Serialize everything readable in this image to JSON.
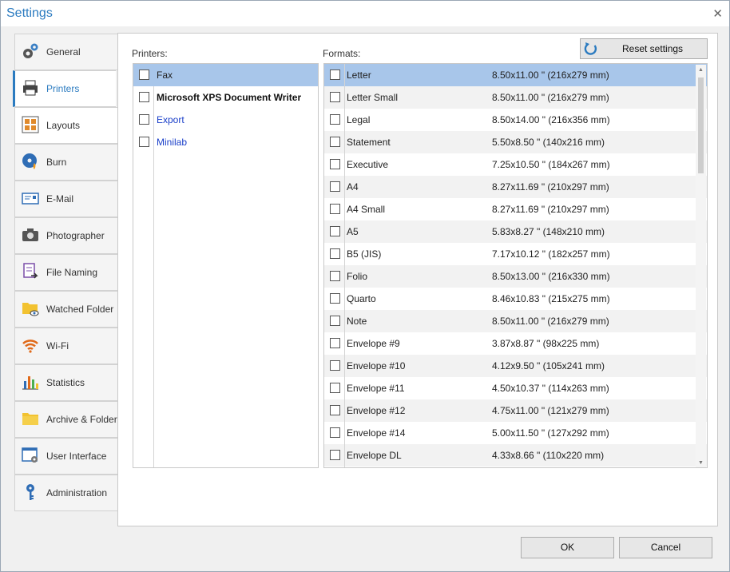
{
  "window": {
    "title": "Settings"
  },
  "sidebar": {
    "items": [
      {
        "label": "General",
        "icon": "gear-icon"
      },
      {
        "label": "Printers",
        "icon": "printer-icon"
      },
      {
        "label": "Layouts",
        "icon": "layouts-icon"
      },
      {
        "label": "Burn",
        "icon": "disc-icon"
      },
      {
        "label": "E-Mail",
        "icon": "email-icon"
      },
      {
        "label": "Photographer",
        "icon": "camera-icon"
      },
      {
        "label": "File Naming",
        "icon": "file-naming-icon"
      },
      {
        "label": "Watched Folder",
        "icon": "watched-folder-icon"
      },
      {
        "label": "Wi-Fi",
        "icon": "wifi-icon"
      },
      {
        "label": "Statistics",
        "icon": "statistics-icon"
      },
      {
        "label": "Archive & Folders",
        "icon": "folder-icon"
      },
      {
        "label": "User Interface",
        "icon": "user-interface-icon"
      },
      {
        "label": "Administration",
        "icon": "key-icon"
      }
    ],
    "active": "Printers"
  },
  "printers": {
    "label": "Printers:",
    "items": [
      "Fax",
      "Microsoft XPS Document Writer",
      "Export",
      "Minilab"
    ]
  },
  "formats": {
    "label": "Formats:",
    "rows": [
      {
        "name": "Letter",
        "size": "8.50x11.00 \" (216x279 mm)"
      },
      {
        "name": "Letter Small",
        "size": "8.50x11.00 \" (216x279 mm)"
      },
      {
        "name": "Legal",
        "size": "8.50x14.00 \" (216x356 mm)"
      },
      {
        "name": "Statement",
        "size": "5.50x8.50 \" (140x216 mm)"
      },
      {
        "name": "Executive",
        "size": "7.25x10.50 \" (184x267 mm)"
      },
      {
        "name": "A4",
        "size": "8.27x11.69 \" (210x297 mm)"
      },
      {
        "name": "A4 Small",
        "size": "8.27x11.69 \" (210x297 mm)"
      },
      {
        "name": "A5",
        "size": "5.83x8.27 \" (148x210 mm)"
      },
      {
        "name": "B5 (JIS)",
        "size": "7.17x10.12 \" (182x257 mm)"
      },
      {
        "name": "Folio",
        "size": "8.50x13.00 \" (216x330 mm)"
      },
      {
        "name": "Quarto",
        "size": "8.46x10.83 \" (215x275 mm)"
      },
      {
        "name": "Note",
        "size": "8.50x11.00 \" (216x279 mm)"
      },
      {
        "name": "Envelope #9",
        "size": "3.87x8.87 \" (98x225 mm)"
      },
      {
        "name": "Envelope #10",
        "size": "4.12x9.50 \" (105x241 mm)"
      },
      {
        "name": "Envelope #11",
        "size": "4.50x10.37 \" (114x263 mm)"
      },
      {
        "name": "Envelope #12",
        "size": "4.75x11.00 \" (121x279 mm)"
      },
      {
        "name": "Envelope #14",
        "size": "5.00x11.50 \" (127x292 mm)"
      },
      {
        "name": "Envelope DL",
        "size": "4.33x8.66 \" (110x220 mm)"
      }
    ]
  },
  "buttons": {
    "reset": "Reset settings",
    "ok": "OK",
    "cancel": "Cancel"
  },
  "colors": {
    "accent": "#2b7bc0",
    "selection": "#a8c6ea",
    "link": "#1a3fc9"
  }
}
